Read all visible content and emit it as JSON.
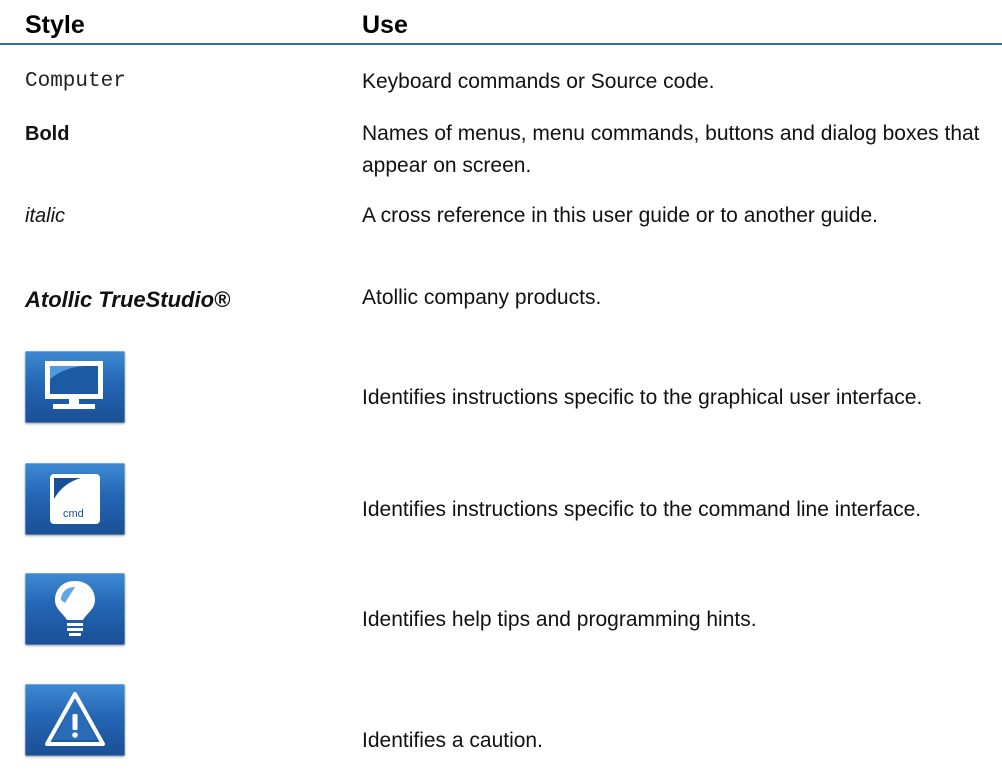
{
  "header": {
    "style_label": "Style",
    "use_label": "Use"
  },
  "rows": [
    {
      "style": "Computer",
      "use": "Keyboard commands or Source code."
    },
    {
      "style": "Bold",
      "use": "Names of menus, menu commands, buttons and dialog boxes that appear on screen."
    },
    {
      "style": "italic",
      "use": "A cross reference in this user guide or to another guide."
    },
    {
      "style": "Atollic TrueStudio®",
      "use": "Atollic company products."
    }
  ],
  "icon_rows": [
    {
      "icon": "monitor-icon",
      "use": "Identifies instructions specific to the graphical user interface."
    },
    {
      "icon": "cmd-icon",
      "use": "Identifies instructions specific to the command line interface.",
      "icon_text": "cmd"
    },
    {
      "icon": "lightbulb-icon",
      "use": "Identifies help tips and programming hints."
    },
    {
      "icon": "warning-icon",
      "use": "Identifies a caution."
    }
  ],
  "colors": {
    "rule": "#2f6db5",
    "icon_bg": "#2466b4"
  }
}
